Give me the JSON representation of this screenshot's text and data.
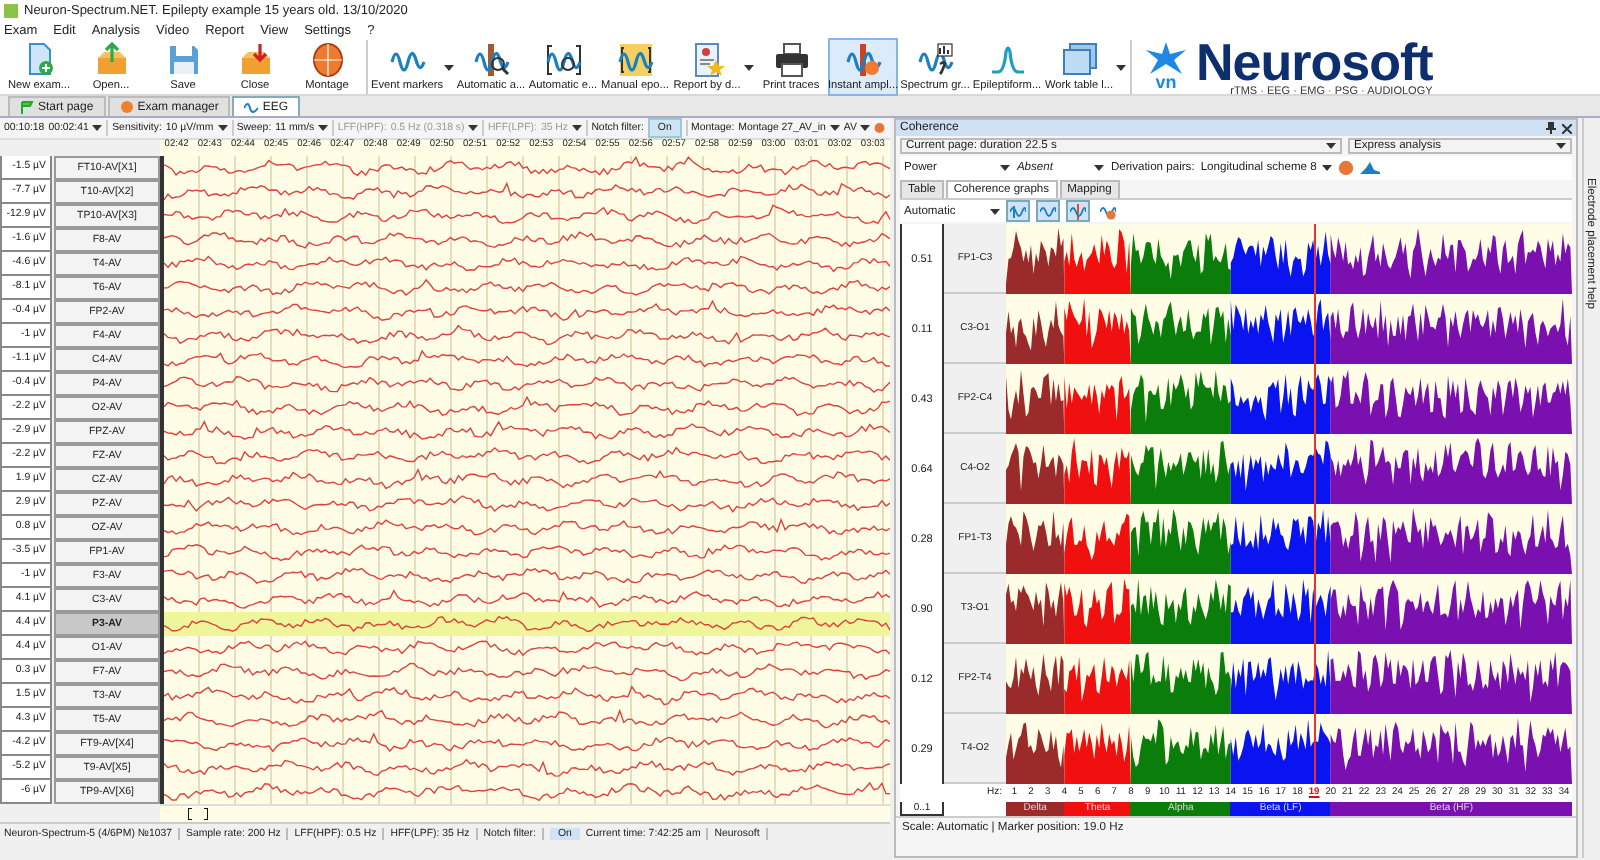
{
  "window": {
    "title": "Neuron-Spectrum.NET. Epilepty example 15 years old. 13/10/2020"
  },
  "menu": [
    "Exam",
    "Edit",
    "Analysis",
    "Video",
    "Report",
    "View",
    "Settings",
    "?"
  ],
  "toolbar": {
    "groups": [
      [
        {
          "label": "New exam...",
          "kind": "new",
          "dropdown": false,
          "selected": false
        },
        {
          "label": "Open...",
          "kind": "open",
          "dropdown": false,
          "selected": false
        },
        {
          "label": "Save",
          "kind": "save",
          "dropdown": false,
          "selected": false
        },
        {
          "label": "Close",
          "kind": "close",
          "dropdown": false,
          "selected": false
        },
        {
          "label": "Montage",
          "kind": "montage",
          "dropdown": false,
          "selected": false
        }
      ],
      [
        {
          "label": "Event markers",
          "kind": "markers",
          "dropdown": true,
          "selected": false
        },
        {
          "label": "Automatic a...",
          "kind": "auto-a",
          "dropdown": false,
          "selected": false
        },
        {
          "label": "Automatic e...",
          "kind": "auto-e",
          "dropdown": false,
          "selected": false
        },
        {
          "label": "Manual epo...",
          "kind": "manual",
          "dropdown": false,
          "selected": false
        },
        {
          "label": "Report by d...",
          "kind": "report",
          "dropdown": true,
          "selected": false
        },
        {
          "label": "Print traces",
          "kind": "print",
          "dropdown": false,
          "selected": false
        },
        {
          "label": "Instant ampl...",
          "kind": "instant",
          "dropdown": false,
          "selected": true
        },
        {
          "label": "Spectrum gr...",
          "kind": "spectrum",
          "dropdown": false,
          "selected": false
        },
        {
          "label": "Epileptiform...",
          "kind": "epi",
          "dropdown": false,
          "selected": false
        },
        {
          "label": "Work table l...",
          "kind": "worktable",
          "dropdown": true,
          "selected": false
        }
      ]
    ]
  },
  "logo": {
    "name": "Neurosoft",
    "suffix": "vn",
    "tagline": "rTMS · EEG · EMG · PSG · AUDIOLOGY"
  },
  "tabs": [
    {
      "label": "Start page",
      "selected": false
    },
    {
      "label": "Exam manager",
      "selected": false
    },
    {
      "label": "EEG",
      "selected": true
    }
  ],
  "eeg": {
    "toolbar": {
      "total_time": "00:10:18",
      "position": "00:02:41",
      "sensitivity_label": "Sensitivity:",
      "sensitivity": "10 µV/mm",
      "sweep_label": "Sweep:",
      "sweep": "11 mm/s",
      "lff_label": "LFF(HPF):",
      "lff": "0.5 Hz (0.318 s)",
      "lff_disabled": true,
      "hff_label": "HFF(LPF):",
      "hff": "35 Hz",
      "hff_disabled": true,
      "notch_label": "Notch filter:",
      "notch": {
        "label": "On",
        "on": true
      },
      "montage_label": "Montage:",
      "montage": "Montage 27_AV_in",
      "reference": "AV"
    },
    "time_labels": [
      "02:42",
      "02:43",
      "02:44",
      "02:45",
      "02:46",
      "02:47",
      "02:48",
      "02:49",
      "02:50",
      "02:51",
      "02:52",
      "02:53",
      "02:54",
      "02:55",
      "02:56",
      "02:57",
      "02:58",
      "02:59",
      "03:00",
      "03:01",
      "03:02",
      "03:03"
    ],
    "channels": [
      {
        "value": "-1.5 µV",
        "label": "FT10-AV[X1]",
        "selected": false
      },
      {
        "value": "-7.7 µV",
        "label": "T10-AV[X2]",
        "selected": false
      },
      {
        "value": "-12.9 µV",
        "label": "TP10-AV[X3]",
        "selected": false
      },
      {
        "value": "-1.6 µV",
        "label": "F8-AV",
        "selected": false
      },
      {
        "value": "-4.6 µV",
        "label": "T4-AV",
        "selected": false
      },
      {
        "value": "-8.1 µV",
        "label": "T6-AV",
        "selected": false
      },
      {
        "value": "-0.4 µV",
        "label": "FP2-AV",
        "selected": false
      },
      {
        "value": "-1 µV",
        "label": "F4-AV",
        "selected": false
      },
      {
        "value": "-1.1 µV",
        "label": "C4-AV",
        "selected": false
      },
      {
        "value": "-0.4 µV",
        "label": "P4-AV",
        "selected": false
      },
      {
        "value": "-2.2 µV",
        "label": "O2-AV",
        "selected": false
      },
      {
        "value": "-2.9 µV",
        "label": "FPZ-AV",
        "selected": false
      },
      {
        "value": "-2.2 µV",
        "label": "FZ-AV",
        "selected": false
      },
      {
        "value": "1.9 µV",
        "label": "CZ-AV",
        "selected": false
      },
      {
        "value": "2.9 µV",
        "label": "PZ-AV",
        "selected": false
      },
      {
        "value": "0.8 µV",
        "label": "OZ-AV",
        "selected": false
      },
      {
        "value": "-3.5 µV",
        "label": "FP1-AV",
        "selected": false
      },
      {
        "value": "-1 µV",
        "label": "F3-AV",
        "selected": false
      },
      {
        "value": "4.1 µV",
        "label": "C3-AV",
        "selected": false
      },
      {
        "value": "4.4 µV",
        "label": "P3-AV",
        "selected": true
      },
      {
        "value": "4.4 µV",
        "label": "O1-AV",
        "selected": false
      },
      {
        "value": "0.3 µV",
        "label": "F7-AV",
        "selected": false
      },
      {
        "value": "1.5 µV",
        "label": "T3-AV",
        "selected": false
      },
      {
        "value": "4.3 µV",
        "label": "T5-AV",
        "selected": false
      },
      {
        "value": "-4.2 µV",
        "label": "FT9-AV[X4]",
        "selected": false
      },
      {
        "value": "-5.2 µV",
        "label": "T9-AV[X5]",
        "selected": false
      },
      {
        "value": "-6 µV",
        "label": "TP9-AV[X6]",
        "selected": false
      }
    ]
  },
  "status_bar": [
    "Neuron-Spectrum-5 (4/6PM) №1037",
    "Sample rate: 200 Hz",
    "LFF(HPF): 0.5 Hz",
    "HFF(LPF): 35 Hz",
    "Notch filter:",
    "On",
    "Current time: 7:42:25 am",
    "Neurosoft"
  ],
  "coherence": {
    "title": "Coherence",
    "page_range": "Current page: duration 22.5 s",
    "analysis": "Express analysis",
    "power_label": "Power",
    "power": "Absent",
    "pairs_label": "Derivation pairs:",
    "pairs": "Longitudinal scheme 8",
    "tabs": [
      {
        "label": "Table",
        "selected": false
      },
      {
        "label": "Coherence graphs",
        "selected": true
      },
      {
        "label": "Mapping",
        "selected": false
      }
    ],
    "scale_mode": "Automatic",
    "tools": [
      {
        "kind": "wave-a",
        "on": true
      },
      {
        "kind": "wave-b",
        "on": true
      },
      {
        "kind": "wave-c",
        "on": true
      },
      {
        "kind": "head",
        "on": false
      }
    ],
    "rows": [
      {
        "value": "0.51",
        "pair": "FP1-C3"
      },
      {
        "value": "0.11",
        "pair": "C3-O1"
      },
      {
        "value": "0.43",
        "pair": "FP2-C4"
      },
      {
        "value": "0.64",
        "pair": "C4-O2"
      },
      {
        "value": "0.28",
        "pair": "FP1-T3"
      },
      {
        "value": "0.90",
        "pair": "T3-O1"
      },
      {
        "value": "0.12",
        "pair": "FP2-T4"
      },
      {
        "value": "0.29",
        "pair": "T4-O2"
      }
    ],
    "range_label": "0..1",
    "hz_label": "Hz:",
    "hz_ticks": [
      {
        "label": "1",
        "marker": false
      },
      {
        "label": "2",
        "marker": false
      },
      {
        "label": "3",
        "marker": false
      },
      {
        "label": "4",
        "marker": false
      },
      {
        "label": "5",
        "marker": false
      },
      {
        "label": "6",
        "marker": false
      },
      {
        "label": "7",
        "marker": false
      },
      {
        "label": "8",
        "marker": false
      },
      {
        "label": "9",
        "marker": false
      },
      {
        "label": "10",
        "marker": false
      },
      {
        "label": "11",
        "marker": false
      },
      {
        "label": "12",
        "marker": false
      },
      {
        "label": "13",
        "marker": false
      },
      {
        "label": "14",
        "marker": false
      },
      {
        "label": "15",
        "marker": false
      },
      {
        "label": "16",
        "marker": false
      },
      {
        "label": "17",
        "marker": false
      },
      {
        "label": "18",
        "marker": false
      },
      {
        "label": "19",
        "marker": true
      },
      {
        "label": "20",
        "marker": false
      },
      {
        "label": "21",
        "marker": false
      },
      {
        "label": "22",
        "marker": false
      },
      {
        "label": "23",
        "marker": false
      },
      {
        "label": "24",
        "marker": false
      },
      {
        "label": "25",
        "marker": false
      },
      {
        "label": "26",
        "marker": false
      },
      {
        "label": "27",
        "marker": false
      },
      {
        "label": "28",
        "marker": false
      },
      {
        "label": "29",
        "marker": false
      },
      {
        "label": "30",
        "marker": false
      },
      {
        "label": "31",
        "marker": false
      },
      {
        "label": "32",
        "marker": false
      },
      {
        "label": "33",
        "marker": false
      },
      {
        "label": "34",
        "marker": false
      }
    ],
    "bands": [
      {
        "name": "Delta",
        "color": "#9b2a2a"
      },
      {
        "name": "Theta",
        "color": "#f01010"
      },
      {
        "name": "Alpha",
        "color": "#0a7d0a"
      },
      {
        "name": "Beta (LF)",
        "color": "#0a14f0"
      },
      {
        "name": "Beta (HF)",
        "color": "#7a10b0"
      }
    ],
    "status": "Scale: Automatic | Marker position: 19.0 Hz"
  },
  "side_tab": "Electrode placement help"
}
